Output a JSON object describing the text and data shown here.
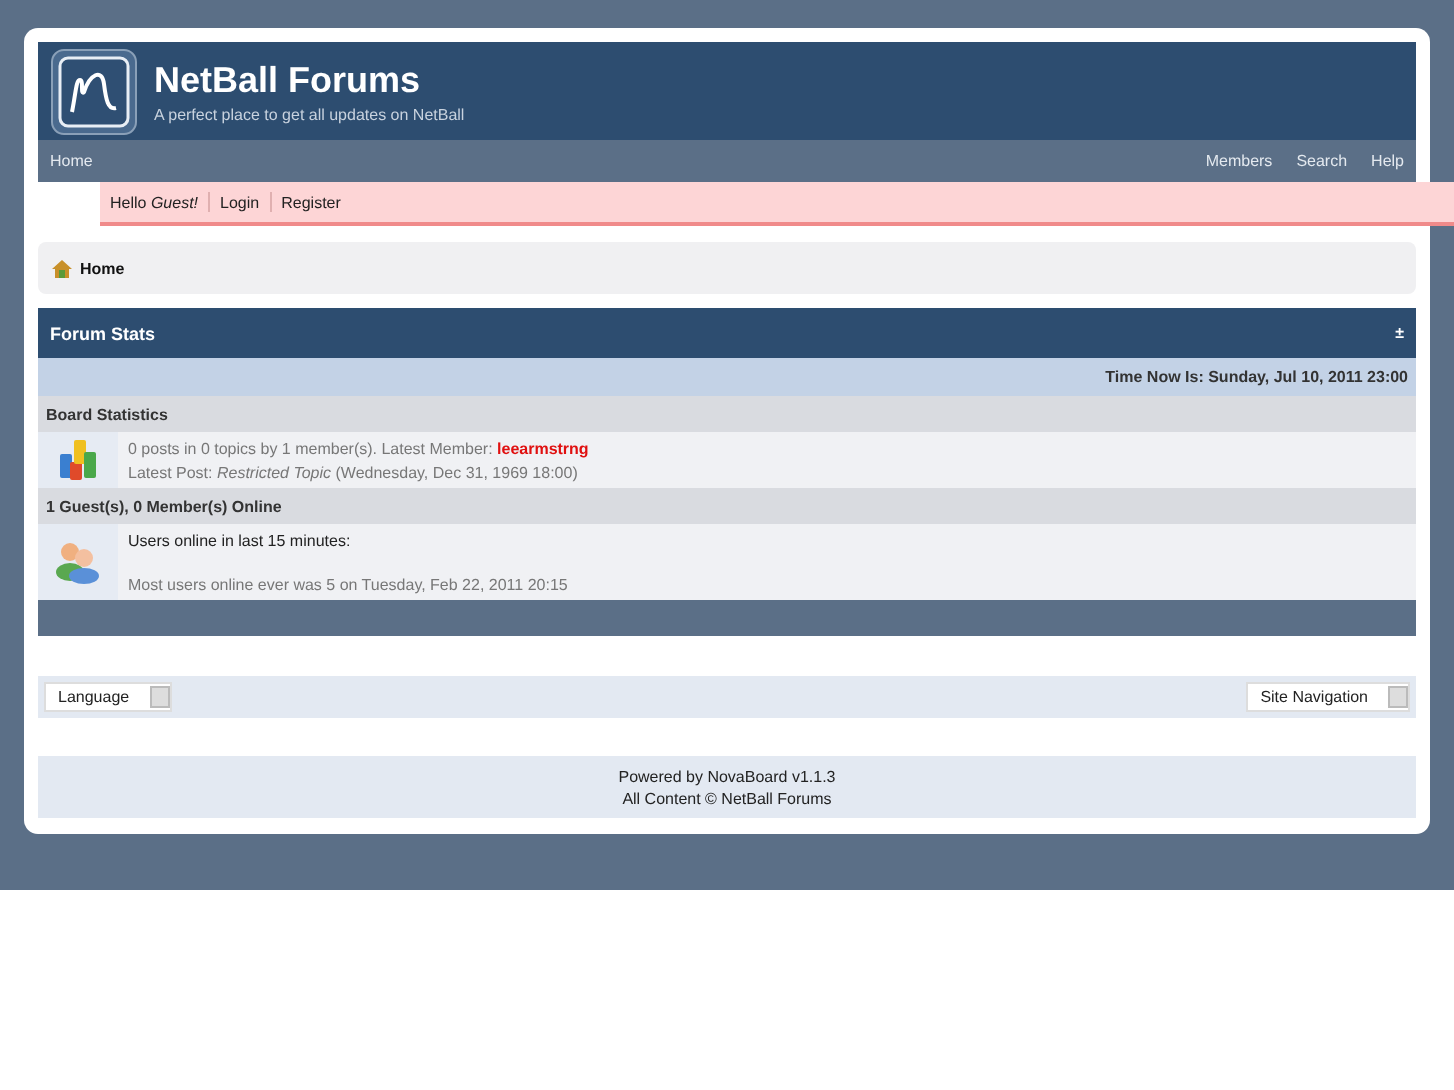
{
  "header": {
    "title": "NetBall Forums",
    "tagline": "A perfect place to get all updates on NetBall"
  },
  "nav": {
    "left": [
      "Home"
    ],
    "right": [
      "Members",
      "Search",
      "Help"
    ]
  },
  "userbar": {
    "greeting": "Hello",
    "user": "Guest!",
    "links": [
      "Login",
      "Register"
    ]
  },
  "breadcrumb": "Home",
  "stats": {
    "title": "Forum Stats",
    "toggle": "±",
    "time": "Time Now Is: Sunday, Jul 10, 2011 23:00",
    "sections": [
      {
        "heading": "Board Statistics",
        "kind": "board",
        "line1": "0 posts in 0 topics by 1 member(s). Latest Member:",
        "member": "leearmstrng",
        "line2_label": "Latest Post:",
        "line2_topic": "Restricted Topic",
        "line2_date": "(Wednesday, Dec 31, 1969 18:00)"
      },
      {
        "heading": "1 Guest(s), 0 Member(s) Online",
        "kind": "online",
        "line1": "Users online in last 15 minutes:",
        "line2": "Most users online ever was 5 on Tuesday, Feb 22, 2011 20:15"
      }
    ]
  },
  "selectors": {
    "left": "Language",
    "right": "Site Navigation"
  },
  "footer": [
    "Powered by NovaBoard v1.1.3",
    "All Content © NetBall Forums"
  ]
}
